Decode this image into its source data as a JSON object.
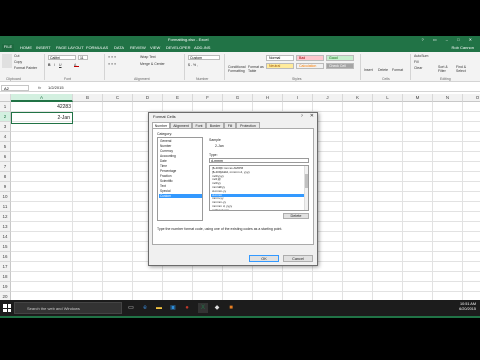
{
  "app": {
    "title": "Formatting.xlsx - Excel",
    "window_controls": "? ▭ – □ ✕",
    "signin": "Rob Cannon"
  },
  "menu": {
    "file": "FILE",
    "tabs": [
      "HOME",
      "INSERT",
      "PAGE LAYOUT",
      "FORMULAS",
      "DATA",
      "REVIEW",
      "VIEW",
      "DEVELOPER",
      "ADD-INS"
    ]
  },
  "ribbon": {
    "clipboard": {
      "cut": "Cut",
      "copy": "Copy",
      "painter": "Format Painter",
      "label": "Clipboard"
    },
    "font": {
      "family": "Calibri",
      "size": "11",
      "label": "Font"
    },
    "alignment": {
      "wrap": "Wrap Text",
      "merge": "Merge & Center",
      "label": "Alignment"
    },
    "number": {
      "format": "Custom",
      "label": "Number"
    },
    "styles": {
      "conditional": "Conditional Formatting",
      "format_table": "Format as Table",
      "cells_normal": "Normal",
      "cells_bad": "Bad",
      "cells_good": "Good",
      "cells_neutral": "Neutral",
      "cells_calc": "Calculation",
      "cells_check": "Check Cell",
      "label": "Styles"
    },
    "cells": {
      "insert": "Insert",
      "delete": "Delete",
      "format": "Format",
      "label": "Cells"
    },
    "editing": {
      "autosum": "AutoSum",
      "fill": "Fill",
      "clear": "Clear",
      "sort": "Sort & Filter",
      "find": "Find & Select",
      "label": "Editing"
    }
  },
  "formula_bar": {
    "name_box": "A2",
    "fx": "fx",
    "value": "1/2/2015"
  },
  "grid": {
    "columns": [
      "A",
      "B",
      "C",
      "D",
      "E",
      "F",
      "G",
      "H",
      "I",
      "J",
      "K",
      "L",
      "M",
      "N",
      "O"
    ],
    "rows": [
      "1",
      "2",
      "3",
      "4",
      "5",
      "6",
      "7",
      "8",
      "9",
      "10",
      "11",
      "12",
      "13",
      "14",
      "15",
      "16",
      "17",
      "18",
      "19",
      "20"
    ],
    "cells": {
      "A1": "42283",
      "A2": "2-Jan"
    }
  },
  "sheet": {
    "tab": "Sheet1",
    "add": "+"
  },
  "status": {
    "left": "READY",
    "right": "100%"
  },
  "dialog": {
    "title": "Format Cells",
    "help": "?",
    "close": "✕",
    "tabs": [
      "Number",
      "Alignment",
      "Font",
      "Border",
      "Fill",
      "Protection"
    ],
    "category_label": "Category:",
    "categories": [
      "General",
      "Number",
      "Currency",
      "Accounting",
      "Date",
      "Time",
      "Percentage",
      "Fraction",
      "Scientific",
      "Text",
      "Special",
      "Custom"
    ],
    "selected_category": "Custom",
    "sample_label": "Sample",
    "sample_value": "2-Jan",
    "type_label": "Type:",
    "type_value": "d-mmm",
    "types": [
      "[$-409]h:mm:ss AM/PM",
      "[$-409]dddd, mmmm d, yyyy",
      "m/d/yyyy",
      "m/d;@",
      "m/d/yy",
      "mm/dd/yy",
      "d-mmm-yy",
      "d-mmm",
      "mmm-yy",
      "mmmm-yy",
      "mmmm d, yyyy",
      "m/d/yy h:mm"
    ],
    "selected_type": "d-mmm",
    "delete": "Delete",
    "hint": "Type the number format code, using one of the existing codes as a starting point.",
    "ok": "OK",
    "cancel": "Cancel"
  },
  "taskbar": {
    "search": "Search the web and Windows",
    "time": "10:51 AM",
    "date": "6/20/2015"
  }
}
